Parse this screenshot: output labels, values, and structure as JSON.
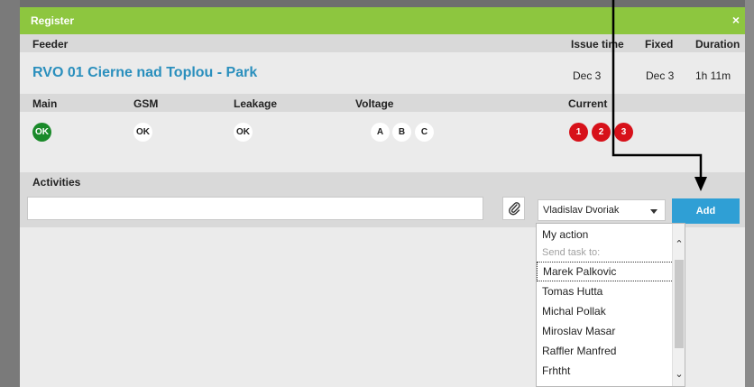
{
  "dialog": {
    "title": "Register",
    "close_glyph": "×"
  },
  "feeder_header": {
    "feeder": "Feeder",
    "issue_time": "Issue time",
    "fixed": "Fixed",
    "duration": "Duration"
  },
  "feeder_row": {
    "name": "RVO 01 Cierne nad Toplou - Park",
    "issue_time": "Dec 3",
    "fixed": "Dec 3",
    "duration": "1h 11m"
  },
  "status_header": {
    "main": "Main",
    "gsm": "GSM",
    "leakage": "Leakage",
    "voltage": "Voltage",
    "current": "Current"
  },
  "status_row": {
    "main": "OK",
    "gsm": "OK",
    "leakage": "OK",
    "voltage": [
      "A",
      "B",
      "C"
    ],
    "current": [
      "1",
      "2",
      "3"
    ]
  },
  "colors": {
    "titlebar": "#8dc63f",
    "feeder_name": "#2a8fbd",
    "ok_green": "#1a8a2a",
    "alarm_red": "#d7111a",
    "add_button": "#2f9fd5"
  },
  "activities": {
    "header": "Activities",
    "input_value": "",
    "attach_icon": "paperclip-icon",
    "assignee": "Vladislav Dvoriak",
    "add_label": "Add"
  },
  "dropdown": {
    "my_action": "My action",
    "group_label": "Send task to:",
    "options": [
      "Marek Palkovic",
      "Tomas Hutta",
      "Michal Pollak",
      "Miroslav Masar",
      "Raffler Manfred",
      "Frhtht"
    ],
    "focused": "Marek Palkovic"
  }
}
